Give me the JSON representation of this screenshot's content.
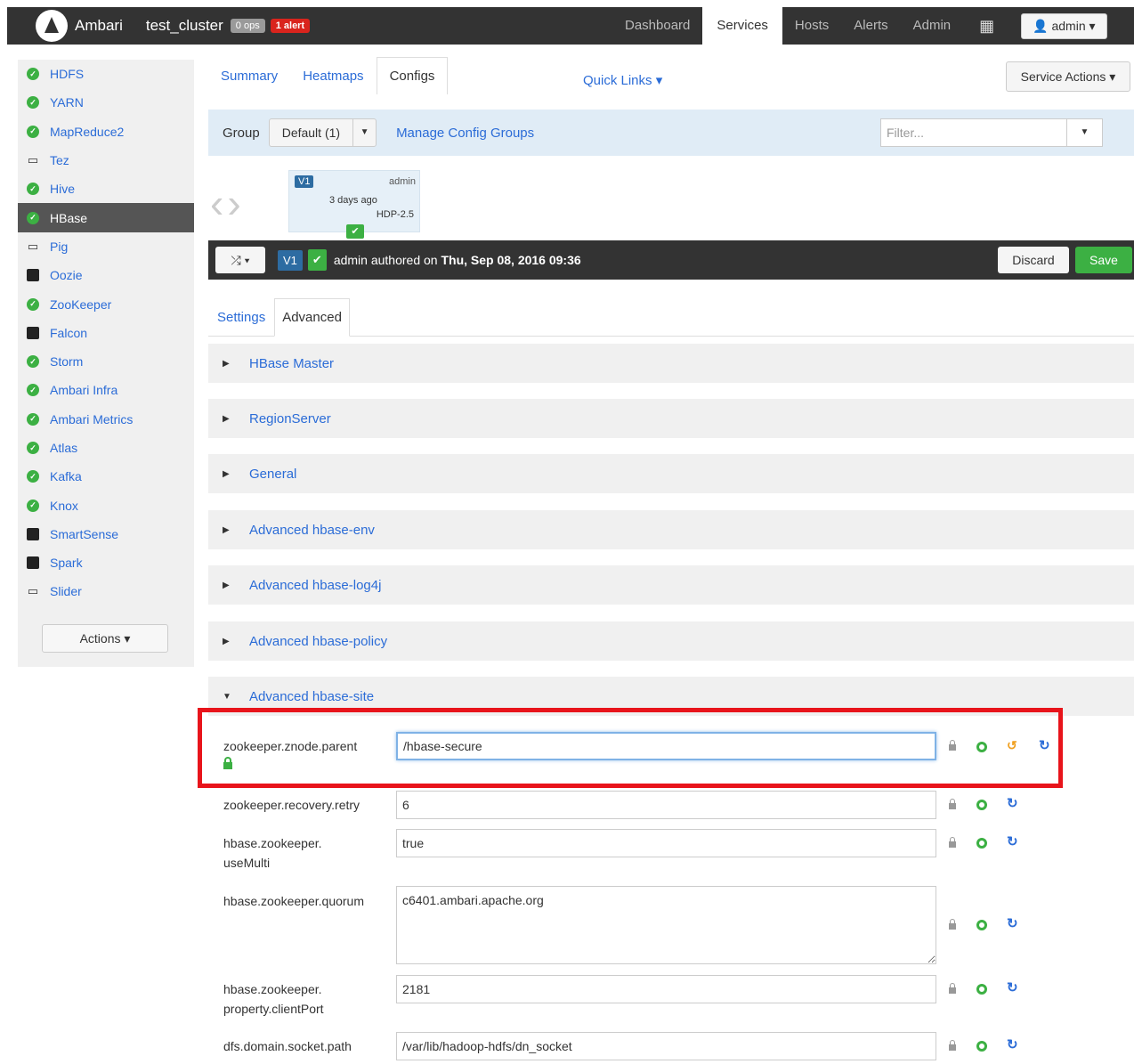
{
  "topnav": {
    "brand": "Ambari",
    "cluster": "test_cluster",
    "ops_badge": "0 ops",
    "alert_badge": "1 alert",
    "links": [
      "Dashboard",
      "Services",
      "Hosts",
      "Alerts",
      "Admin"
    ],
    "active_link": "Services",
    "user": "admin"
  },
  "sidebar": {
    "services": [
      {
        "name": "HDFS",
        "status": "ok"
      },
      {
        "name": "YARN",
        "status": "ok"
      },
      {
        "name": "MapReduce2",
        "status": "ok"
      },
      {
        "name": "Tez",
        "status": "client"
      },
      {
        "name": "Hive",
        "status": "ok"
      },
      {
        "name": "HBase",
        "status": "ok"
      },
      {
        "name": "Pig",
        "status": "client"
      },
      {
        "name": "Oozie",
        "status": "stopped"
      },
      {
        "name": "ZooKeeper",
        "status": "ok"
      },
      {
        "name": "Falcon",
        "status": "stopped"
      },
      {
        "name": "Storm",
        "status": "ok"
      },
      {
        "name": "Ambari Infra",
        "status": "ok"
      },
      {
        "name": "Ambari Metrics",
        "status": "ok"
      },
      {
        "name": "Atlas",
        "status": "ok"
      },
      {
        "name": "Kafka",
        "status": "ok"
      },
      {
        "name": "Knox",
        "status": "ok"
      },
      {
        "name": "SmartSense",
        "status": "stopped"
      },
      {
        "name": "Spark",
        "status": "stopped"
      },
      {
        "name": "Slider",
        "status": "client"
      }
    ],
    "active": "HBase",
    "actions_label": "Actions ▾"
  },
  "tabs": {
    "items": [
      "Summary",
      "Heatmaps",
      "Configs"
    ],
    "active": "Configs",
    "quick_links": "Quick Links ▾",
    "service_actions": "Service Actions ▾"
  },
  "groupbar": {
    "label": "Group",
    "selected": "Default (1)",
    "manage": "Manage Config Groups",
    "filter_placeholder": "Filter..."
  },
  "version": {
    "badge": "V1",
    "user": "admin",
    "ago": "3 days ago",
    "stack": "HDP-2.5"
  },
  "compare": {
    "badge": "V1",
    "author": "admin",
    "middle": "authored on",
    "date": "Thu, Sep 08, 2016 09:36",
    "discard": "Discard",
    "save": "Save"
  },
  "subtabs": {
    "items": [
      "Settings",
      "Advanced"
    ],
    "active": "Advanced"
  },
  "sections": [
    {
      "title": "HBase Master",
      "expanded": false
    },
    {
      "title": "RegionServer",
      "expanded": false
    },
    {
      "title": "General",
      "expanded": false
    },
    {
      "title": "Advanced hbase-env",
      "expanded": false
    },
    {
      "title": "Advanced hbase-log4j",
      "expanded": false
    },
    {
      "title": "Advanced hbase-policy",
      "expanded": false
    },
    {
      "title": "Advanced hbase-site",
      "expanded": true
    }
  ],
  "properties": [
    {
      "label_line1": "zookeeper.znode.parent",
      "label_line2": "",
      "value": "/hbase-secure",
      "modified": true
    },
    {
      "label_line1": "zookeeper.recovery.retry",
      "label_line2": "",
      "value": "6",
      "modified": false
    },
    {
      "label_line1": "hbase.zookeeper.",
      "label_line2": "useMulti",
      "value": "true",
      "modified": false
    },
    {
      "label_line1": "hbase.zookeeper.quorum",
      "label_line2": "",
      "value": "c6401.ambari.apache.org",
      "modified": false
    },
    {
      "label_line1": "hbase.zookeeper.",
      "label_line2": "property.clientPort",
      "value": "2181",
      "modified": false
    },
    {
      "label_line1": "dfs.domain.socket.path",
      "label_line2": "",
      "value": "/var/lib/hadoop-hdfs/dn_socket",
      "modified": false
    }
  ],
  "colors": {
    "link": "#2b6cd7",
    "ok": "#3cb043",
    "alert": "#d9241d",
    "highlight": "#e8141b",
    "topbar": "#333333"
  }
}
